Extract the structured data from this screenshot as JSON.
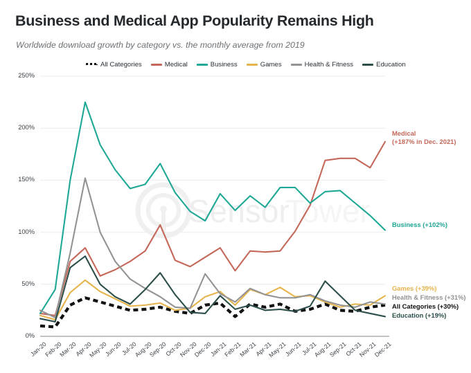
{
  "title": "Business and Medical App Popularity Remains High",
  "subtitle": "Worldwide download growth by category vs. the monthly average from 2019",
  "watermark": {
    "part1": "Sensor",
    "part2": "Tower",
    "logo": "sensor-tower-logo"
  },
  "legend": {
    "position": "top",
    "items": [
      {
        "label": "All Categories",
        "color": "#111111",
        "style": "dashed"
      },
      {
        "label": "Medical",
        "color": "#c4685a",
        "style": "solid"
      },
      {
        "label": "Business",
        "color": "#1fa896",
        "style": "solid"
      },
      {
        "label": "Games",
        "color": "#e7b44c",
        "style": "solid"
      },
      {
        "label": "Health & Fitness",
        "color": "#939393",
        "style": "solid"
      },
      {
        "label": "Education",
        "color": "#2c4f4b",
        "style": "solid"
      }
    ]
  },
  "annotations": [
    {
      "name": "medical",
      "line1": "Medical",
      "line2": "(+187% in Dec. 2021)",
      "color": "#c4685a"
    },
    {
      "name": "business",
      "line1": "Business (+102%)",
      "line2": "",
      "color": "#1fa896"
    },
    {
      "name": "games",
      "line1": "Games (+39%)",
      "line2": "",
      "color": "#e7b44c"
    },
    {
      "name": "health-fitness",
      "line1": "Health & Fitness (+31%)",
      "line2": "",
      "color": "#939393"
    },
    {
      "name": "all-categories",
      "line1": "All Categories (+30%)",
      "line2": "",
      "color": "#111111"
    },
    {
      "name": "education",
      "line1": "Education (+19%)",
      "line2": "",
      "color": "#2c4f4b"
    }
  ],
  "chart_data": {
    "type": "line",
    "title": "Business and Medical App Popularity Remains High",
    "subtitle": "Worldwide download growth by category vs. the monthly average from 2019",
    "xlabel": "",
    "ylabel": "",
    "ylim": [
      0,
      250
    ],
    "yticks": [
      0,
      50,
      100,
      150,
      200,
      250
    ],
    "ytick_labels": [
      "0%",
      "50%",
      "100%",
      "150%",
      "200%",
      "250%"
    ],
    "grid": true,
    "legend_position": "top",
    "categories": [
      "Jan-20",
      "Feb-20",
      "Mar-20",
      "Apr-20",
      "May-20",
      "Jun-20",
      "Jul-20",
      "Aug-20",
      "Sep-20",
      "Oct-20",
      "Nov-20",
      "Dec-20",
      "Jan-21",
      "Feb-21",
      "Mar-21",
      "Apr-21",
      "May-21",
      "Jun-21",
      "Jul-21",
      "Aug-21",
      "Sep-21",
      "Oct-21",
      "Nov-21",
      "Dec-21"
    ],
    "series": [
      {
        "name": "All Categories",
        "color": "#111111",
        "style": "dashed",
        "values": [
          10,
          9,
          30,
          37,
          33,
          29,
          25,
          26,
          28,
          24,
          22,
          30,
          32,
          19,
          31,
          28,
          31,
          24,
          26,
          31,
          25,
          24,
          28,
          30
        ]
      },
      {
        "name": "Medical",
        "color": "#c4685a",
        "style": "solid",
        "values": [
          22,
          20,
          72,
          85,
          58,
          64,
          72,
          82,
          107,
          73,
          67,
          76,
          85,
          63,
          82,
          81,
          82,
          101,
          126,
          169,
          171,
          171,
          162,
          187
        ]
      },
      {
        "name": "Business",
        "color": "#1fa896",
        "style": "solid",
        "values": [
          22,
          45,
          150,
          225,
          184,
          160,
          142,
          146,
          166,
          138,
          120,
          111,
          137,
          121,
          135,
          124,
          143,
          143,
          128,
          139,
          140,
          128,
          116,
          102
        ]
      },
      {
        "name": "Games",
        "color": "#e7b44c",
        "style": "solid",
        "values": [
          20,
          16,
          42,
          54,
          43,
          36,
          29,
          30,
          32,
          25,
          27,
          38,
          43,
          30,
          45,
          40,
          47,
          38,
          39,
          33,
          28,
          31,
          30,
          39
        ]
      },
      {
        "name": "Health & Fitness",
        "color": "#939393",
        "style": "solid",
        "values": [
          25,
          18,
          80,
          152,
          100,
          72,
          55,
          46,
          38,
          28,
          27,
          60,
          41,
          33,
          46,
          40,
          37,
          37,
          40,
          34,
          30,
          28,
          33,
          31
        ]
      },
      {
        "name": "Education",
        "color": "#2c4f4b",
        "style": "solid",
        "values": [
          17,
          14,
          66,
          77,
          50,
          38,
          31,
          45,
          61,
          40,
          23,
          22,
          39,
          26,
          30,
          25,
          26,
          24,
          29,
          53,
          39,
          25,
          22,
          19
        ]
      }
    ]
  }
}
